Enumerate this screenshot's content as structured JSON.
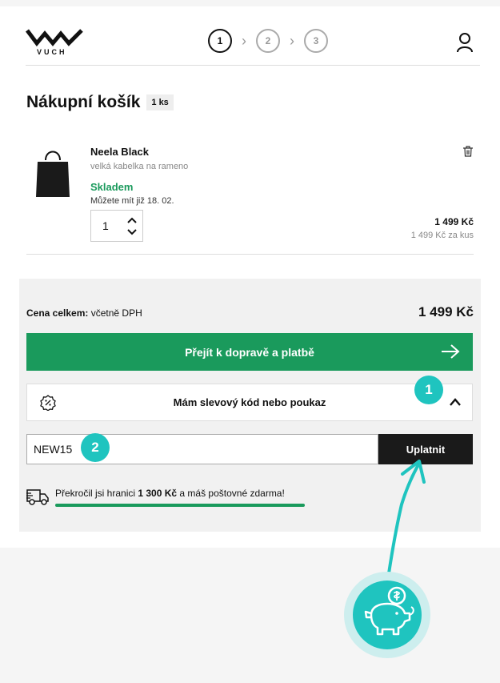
{
  "header": {
    "logo_text": "VUCH",
    "steps": [
      "1",
      "2",
      "3"
    ],
    "separator": "›"
  },
  "cart": {
    "title": "Nákupní košík",
    "count": "1 ks"
  },
  "item": {
    "name": "Neela Black",
    "subtitle": "velká kabelka na rameno",
    "stock": "Skladem",
    "delivery": "Můžete mít již 18. 02.",
    "quantity": "1",
    "price": "1 499 Kč",
    "unit_price": "1 499 Kč za kus"
  },
  "summary": {
    "total_label": "Cena celkem:",
    "total_note": "včetně DPH",
    "total_price": "1 499 Kč",
    "checkout_label": "Přejít k dopravě a platbě",
    "coupon_toggle": "Mám slevový kód nebo poukaz",
    "coupon_value": "NEW15",
    "apply_label": "Uplatnit",
    "shipping_prefix": "Překročil jsi hranici",
    "shipping_amount": "1 300 Kč",
    "shipping_suffix": "a máš poštovné zdarma!",
    "shipping_progress": 1.0
  },
  "annotations": {
    "badge_1": "1",
    "badge_2": "2"
  },
  "colors": {
    "accent_green": "#1a9a5c",
    "annotation_teal": "#1fc4bf",
    "dark_button": "#1a1a1a"
  },
  "icons": [
    "user-icon",
    "trash-icon",
    "arrow-right-icon",
    "discount-icon",
    "chevron-up-icon",
    "truck-icon",
    "piggy-bank-icon"
  ]
}
